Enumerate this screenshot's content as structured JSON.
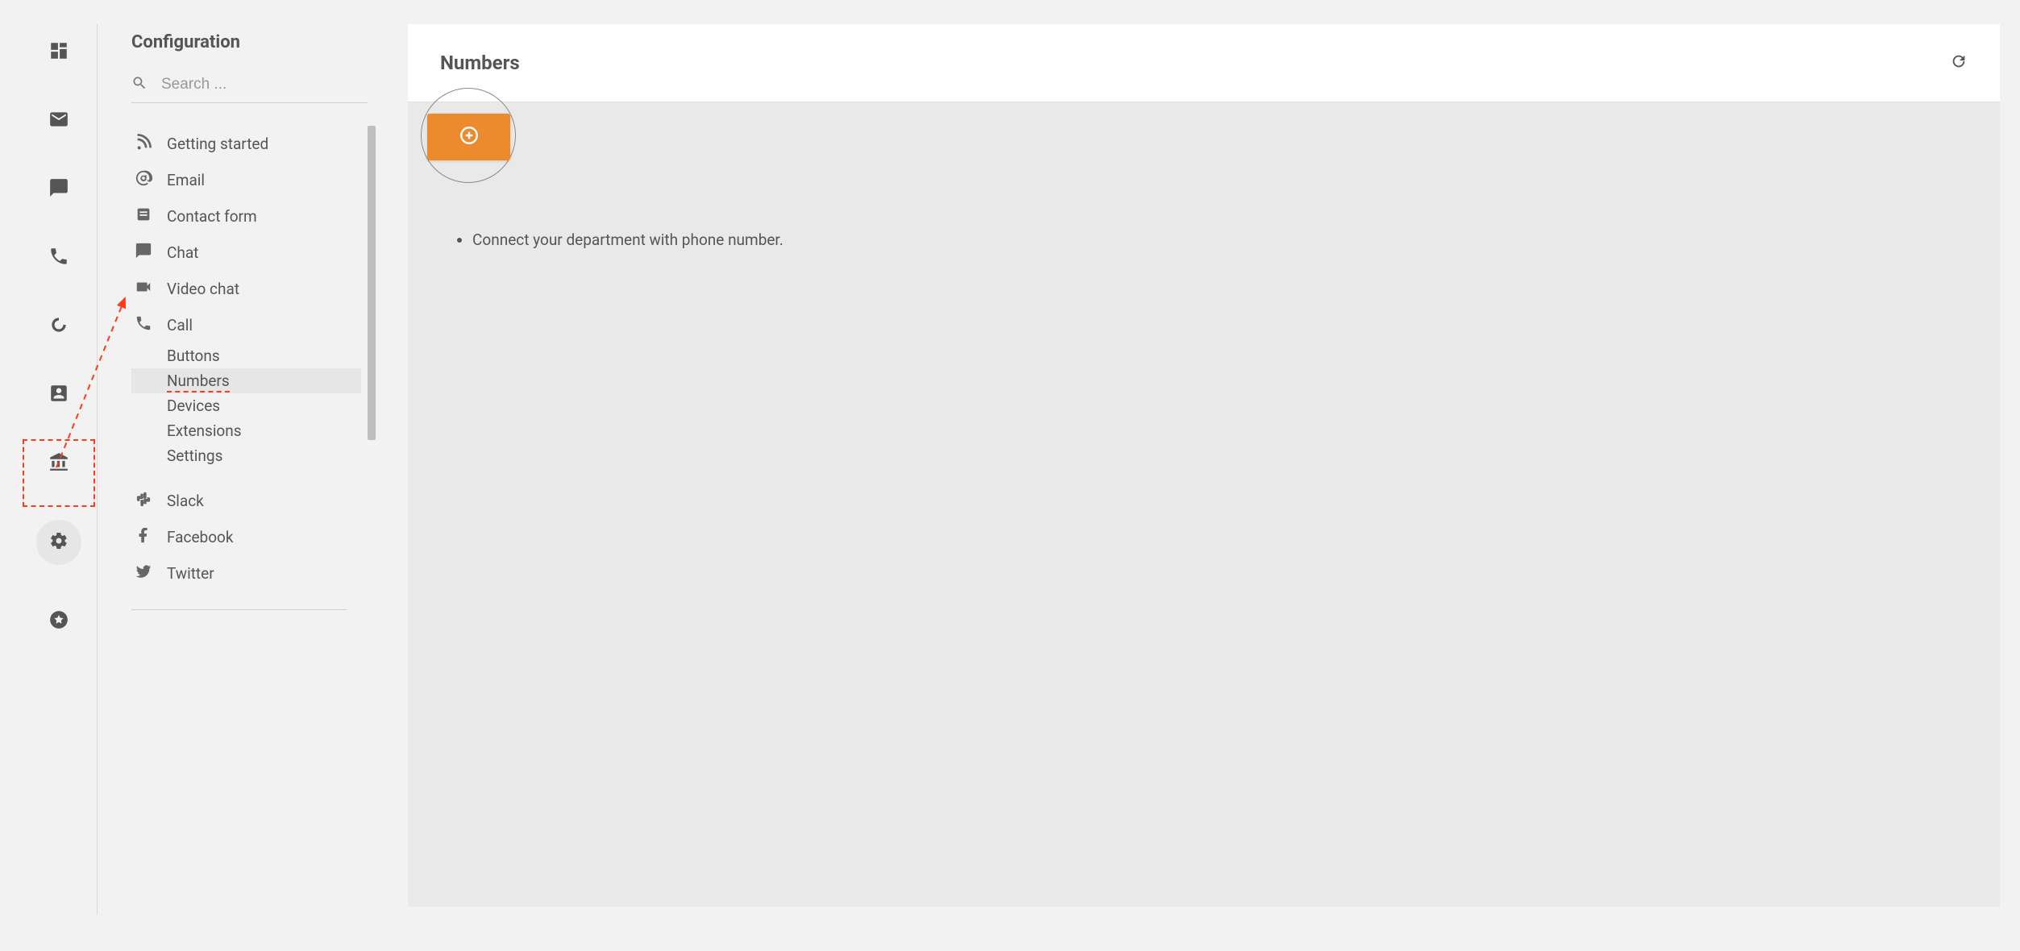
{
  "sidebar": {
    "title": "Configuration",
    "search_placeholder": "Search ...",
    "items": {
      "getting_started": "Getting started",
      "email": "Email",
      "contact_form": "Contact form",
      "chat": "Chat",
      "video_chat": "Video chat",
      "call": "Call",
      "slack": "Slack",
      "facebook": "Facebook",
      "twitter": "Twitter"
    },
    "call_sub": {
      "buttons": "Buttons",
      "numbers": "Numbers",
      "devices": "Devices",
      "extensions": "Extensions",
      "settings": "Settings"
    }
  },
  "main": {
    "title": "Numbers",
    "bullet1": "Connect your department with phone number."
  }
}
